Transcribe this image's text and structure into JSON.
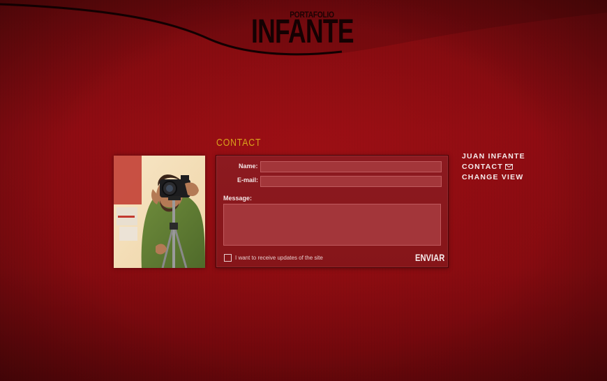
{
  "brand": {
    "subtitle": "PORTAFOLIO",
    "name": "INFANTE"
  },
  "page": {
    "heading": "CONTACT"
  },
  "form": {
    "name_label": "Name:",
    "email_label": "E-mail:",
    "message_label": "Message:",
    "name_value": "",
    "email_value": "",
    "message_value": "",
    "updates_label": "I want to receive updates of the site",
    "updates_checked": false,
    "submit_label": "ENVIAR"
  },
  "nav": {
    "items": [
      {
        "label": "JUAN INFANTE",
        "icon": ""
      },
      {
        "label": "CONTACT",
        "icon": "envelope-icon"
      },
      {
        "label": "CHANGE VIEW",
        "icon": ""
      }
    ]
  },
  "photo": {
    "icon": "photographer-portrait-image"
  },
  "colors": {
    "background": "#8e0c12",
    "heading_accent": "#d9a21c",
    "logo_text": "#140102",
    "nav_text": "#f5ecec",
    "panel": "#8c1a20"
  }
}
